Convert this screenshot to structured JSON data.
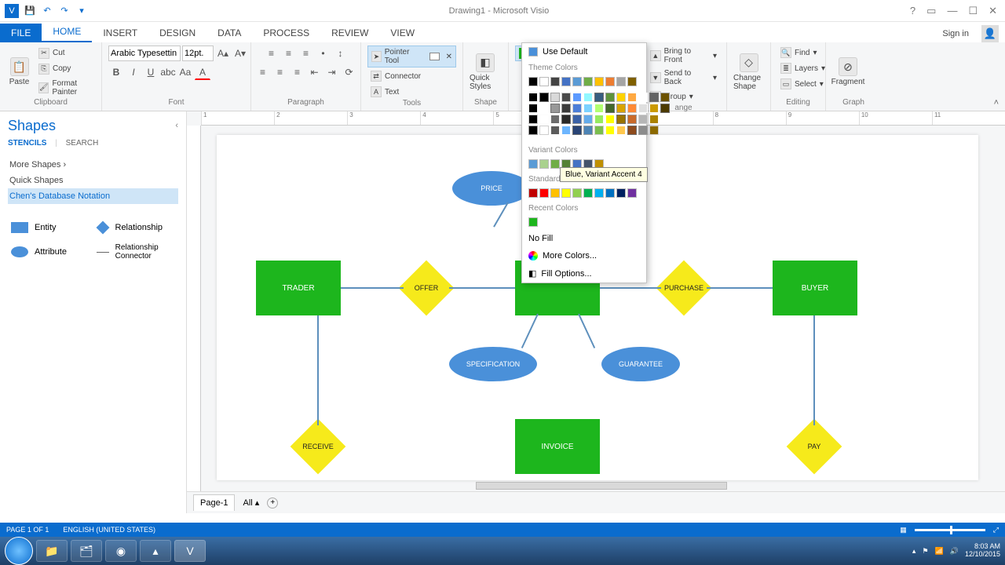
{
  "titlebar": {
    "title": "Drawing1 - Microsoft Visio"
  },
  "ribbon": {
    "tabs": {
      "file": "FILE",
      "home": "HOME",
      "insert": "INSERT",
      "design": "DESIGN",
      "data": "DATA",
      "process": "PROCESS",
      "review": "REVIEW",
      "view": "VIEW"
    },
    "signin": "Sign in",
    "clipboard": {
      "paste": "Paste",
      "cut": "Cut",
      "copy": "Copy",
      "format_painter": "Format Painter",
      "label": "Clipboard"
    },
    "font": {
      "family": "Arabic Typesettin",
      "size": "12pt.",
      "label": "Font"
    },
    "paragraph": {
      "label": "Paragraph"
    },
    "tools": {
      "pointer": "Pointer Tool",
      "connector": "Connector",
      "text": "Text",
      "label": "Tools"
    },
    "shape_styles": {
      "quick": "Quick Styles",
      "fill": "Fill",
      "label": "Shape"
    },
    "arrange": {
      "bring": "Bring to Front",
      "send": "Send to Back",
      "group": "Group",
      "change": "Change Shape",
      "label": "ange"
    },
    "editing": {
      "find": "Find",
      "layers": "Layers",
      "select": "Select",
      "label": "Editing"
    },
    "graph": {
      "fragment": "Fragment",
      "label": "Graph"
    }
  },
  "fill_dropdown": {
    "use_default": "Use Default",
    "theme_colors": "Theme Colors",
    "variant_colors": "Variant Colors",
    "standard": "Standard",
    "recent": "Recent Colors",
    "no_fill": "No Fill",
    "more": "More Colors...",
    "options": "Fill Options...",
    "tooltip": "Blue, Variant Accent 4",
    "theme_row1": [
      "#000000",
      "#ffffff",
      "#444444",
      "#4472c4",
      "#5b9bd5",
      "#70ad47",
      "#ffc000",
      "#ed7d31",
      "#a5a5a5",
      "#7f6000"
    ],
    "variant_row": [
      "#5b9bd5",
      "#a9d18e",
      "#70ad47",
      "#548235",
      "#4472c4",
      "#44546a",
      "#bf9000"
    ],
    "standard_row": [
      "#c00000",
      "#ff0000",
      "#ffc000",
      "#ffff00",
      "#92d050",
      "#00b050",
      "#00b0f0",
      "#0070c0",
      "#002060",
      "#7030a0"
    ],
    "recent_row": [
      "#1db61d"
    ]
  },
  "shapes_panel": {
    "title": "Shapes",
    "stencils": "STENCILS",
    "search": "SEARCH",
    "more": "More Shapes",
    "quick": "Quick Shapes",
    "chens": "Chen's Database Notation",
    "entity": "Entity",
    "relationship": "Relationship",
    "attribute": "Attribute",
    "connector": "Relationship Connector"
  },
  "diagram": {
    "entities": {
      "trader": "TRADER",
      "buyer": "BUYER",
      "invoice": "INVOICE"
    },
    "relationships": {
      "offer": "OFFER",
      "purchase": "PURCHASE",
      "receive": "RECEIVE",
      "pay": "PAY"
    },
    "attributes": {
      "price": "PRICE",
      "specification": "SPECIFICATION",
      "guarantee": "GUARANTEE"
    }
  },
  "pagetabs": {
    "page1": "Page-1",
    "all": "All"
  },
  "statusbar": {
    "page": "PAGE 1 OF 1",
    "lang": "ENGLISH (UNITED STATES)"
  },
  "taskbar": {
    "time": "8:03 AM",
    "date": "12/10/2015"
  }
}
